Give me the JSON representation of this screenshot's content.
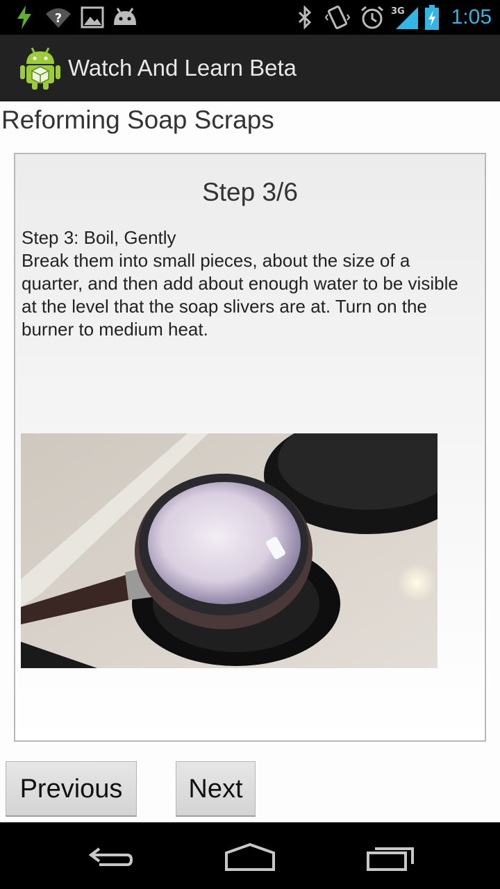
{
  "status_bar": {
    "time": "1:05",
    "network_label": "3G",
    "icons": [
      "charging-bolt-icon",
      "wifi-unknown-icon",
      "gallery-icon",
      "android-head-icon",
      "bluetooth-icon",
      "vibrate-icon",
      "alarm-icon",
      "signal-icon",
      "battery-icon"
    ],
    "accent_color": "#33b5e5"
  },
  "action_bar": {
    "title": "Watch And Learn Beta",
    "icon": "android-app-icon"
  },
  "page": {
    "title": "Reforming Soap Scraps"
  },
  "step": {
    "counter": "Step 3/6",
    "heading": "Step 3: Boil, Gently",
    "body": "Break them into small pieces, about the size of a quarter, and then add about enough water to be visible at the level that the soap slivers are at. Turn on the burner to medium heat.",
    "image": "pot-of-boiling-soap-photo"
  },
  "buttons": {
    "previous": "Previous",
    "next": "Next"
  },
  "nav_bar": {
    "icons": [
      "back-icon",
      "home-icon",
      "recent-apps-icon"
    ]
  }
}
